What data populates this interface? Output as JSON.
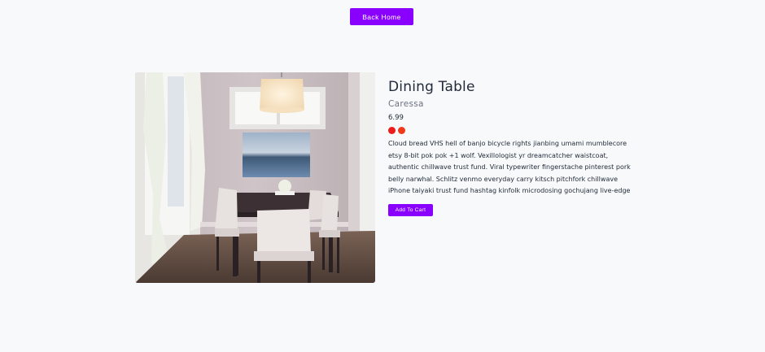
{
  "nav": {
    "back_home_label": "Back Home"
  },
  "product": {
    "image_alt": "Dining room with table and chairs",
    "title": "Dining Table",
    "brand": "Caressa",
    "price": "6.99",
    "colors": [
      "#ee1b1b",
      "#f0381b"
    ],
    "description": "Cloud bread VHS hell of banjo bicycle rights jianbing umami mumblecore etsy 8-bit pok pok +1 wolf. Vexillologist yr dreamcatcher waistcoat, authentic chillwave trust fund. Viral typewriter fingerstache pinterest pork belly narwhal. Schlitz venmo everyday carry kitsch pitchfork chillwave iPhone taiyaki trust fund hashtag kinfolk microdosing gochujang live-edge",
    "add_to_cart_label": "Add To Cart"
  },
  "accent_color": "#8a00ff"
}
